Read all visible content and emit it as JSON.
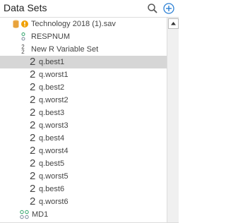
{
  "header": {
    "title": "Data Sets"
  },
  "tree": {
    "file": {
      "label": "Technology 2018 (1).sav"
    },
    "respnum": {
      "label": "RESPNUM"
    },
    "varset": {
      "label": "New R Variable Set"
    },
    "items": [
      {
        "label": "q.best1"
      },
      {
        "label": "q.worst1"
      },
      {
        "label": "q.best2"
      },
      {
        "label": "q.worst2"
      },
      {
        "label": "q.best3"
      },
      {
        "label": "q.worst3"
      },
      {
        "label": "q.best4"
      },
      {
        "label": "q.worst4"
      },
      {
        "label": "q.best5"
      },
      {
        "label": "q.worst5"
      },
      {
        "label": "q.best6"
      },
      {
        "label": "q.worst6"
      }
    ],
    "md": {
      "label": "MD1"
    },
    "selected_label": "q.best1"
  },
  "icons": {
    "search": "search-icon",
    "add": "add-circle-icon",
    "database": "database-icon",
    "warning": "warning-icon",
    "numeric": "numeric-variable-icon",
    "set": "variable-set-icon",
    "item": "item-variable-icon",
    "multi": "multi-variable-icon"
  },
  "colors": {
    "accent": "#2a7fd4",
    "warning": "#f0a000",
    "database": "#e8a33c",
    "selected": "#d6d6d6"
  }
}
